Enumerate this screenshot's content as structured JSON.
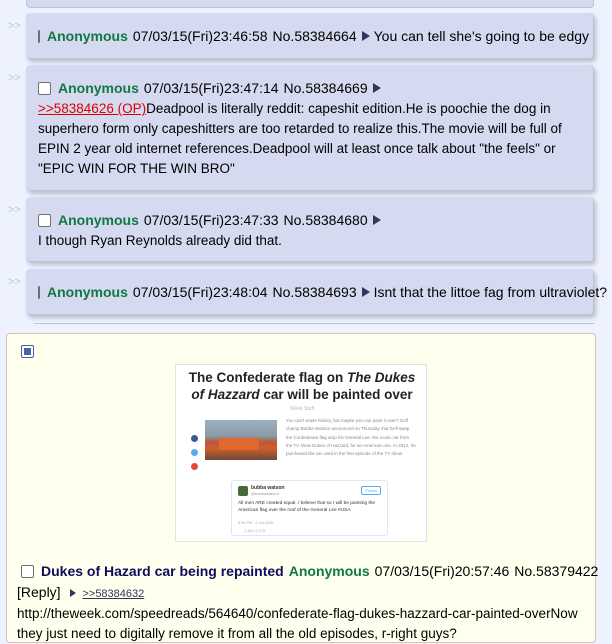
{
  "replies": [
    {
      "name": "Anonymous",
      "datetime": "07/03/15(Fri)23:46:58",
      "post_no": "No.58384664",
      "text": "You can tell she's going to be edgy"
    },
    {
      "name": "Anonymous",
      "datetime": "07/03/15(Fri)23:47:14",
      "post_no": "No.58384669",
      "quote": ">>58384626 (OP)",
      "text": "Deadpool is literally reddit: capeshit edition.He is poochie the dog in superhero form only capeshitters are too retarded to realize this.The movie will be full of EPIN 2 year old internet references.Deadpool will at least once talk about \"the feels\" or \"EPIC WIN FOR THE WIN BRO\""
    },
    {
      "name": "Anonymous",
      "datetime": "07/03/15(Fri)23:47:33",
      "post_no": "No.58384680",
      "text": "I though Ryan Reynolds already did that."
    },
    {
      "name": "Anonymous",
      "datetime": "07/03/15(Fri)23:48:04",
      "post_no": "No.58384693",
      "text": "Isnt that the littoe fag from ultraviolet?"
    }
  ],
  "side_marker": ">>",
  "op": {
    "subject": "Dukes of Hazard car being repainted",
    "name": "Anonymous",
    "datetime": "07/03/15(Fri)20:57:46",
    "post_no": "No.58379422",
    "reply_link": "[Reply]",
    "backlink": ">>58384632",
    "text": "http://theweek.com/speedreads/564640/confederate-flag-dukes-hazzard-car-painted-overNow they just need to digitally remove it from all the old episodes, r-right guys?",
    "thumbnail": {
      "title_html_plain": "The Confederate flag on The Dukes of Hazzard car will be painted over",
      "title_part1": "The Confederate flag on ",
      "title_italic": "The Dukes of Hazzard",
      "title_part2": " car will be painted over",
      "meta": "Week Staff",
      "paragraph": "You can't erase history, but maybe you can paint it over? Golf champ Bubba Watson announced on Thursday that he'll swap the Confederate flag atop his General Lee, the iconic car from the TV show Dukes of Hazzard, for an American one. In 2012, he purchased the car used in the first episode of the TV show.",
      "tweet_name": "bubba watson",
      "tweet_handle": "@bubbawatson",
      "tweet_follow": "Follow",
      "tweet_text": "All men ARE created equal. I believe that so I will be painting the American flag over the roof of the General Lee #USA",
      "tweet_meta": "6:16 PM - 2 Jul 2015",
      "tweet_stats": "1,464   2,175"
    }
  },
  "colors": {
    "name_green": "#117743",
    "subject_blue": "#0f0c5d",
    "quote_red": "#dd0000",
    "reply_bg": "#d6daf0",
    "op_bg": "#ffffee",
    "page_bg": "#eef2ff"
  },
  "icons": [
    "checkbox-icon",
    "play-triangle-icon",
    "minus-toggle-icon"
  ]
}
